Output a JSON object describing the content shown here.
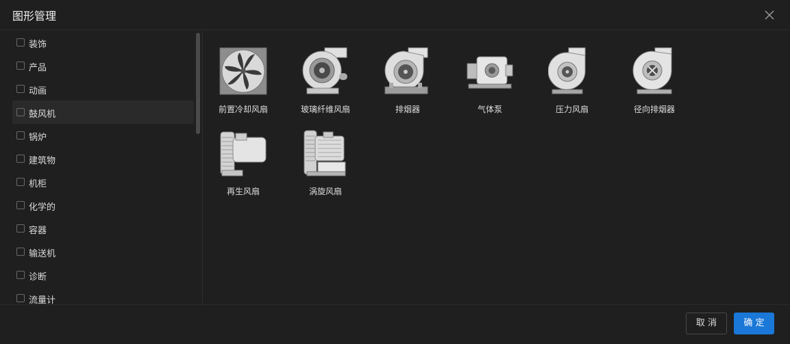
{
  "dialog": {
    "title": "图形管理"
  },
  "sidebar": {
    "items": [
      {
        "label": "装饰"
      },
      {
        "label": "产品"
      },
      {
        "label": "动画"
      },
      {
        "label": "鼓风机"
      },
      {
        "label": "锅炉"
      },
      {
        "label": "建筑物"
      },
      {
        "label": "机柜"
      },
      {
        "label": "化学的"
      },
      {
        "label": "容器"
      },
      {
        "label": "输送机"
      },
      {
        "label": "诊断"
      },
      {
        "label": "流量计"
      }
    ],
    "active_index": 3
  },
  "gallery": {
    "items": [
      {
        "label": "前置冷却风扇",
        "icon": "cooling-fan-icon"
      },
      {
        "label": "玻璃纤维风扇",
        "icon": "fiberglass-fan-icon"
      },
      {
        "label": "排烟器",
        "icon": "smoke-exhauster-icon"
      },
      {
        "label": "气体泵",
        "icon": "gas-pump-icon"
      },
      {
        "label": "压力风扇",
        "icon": "pressure-fan-icon"
      },
      {
        "label": "径向排烟器",
        "icon": "radial-exhauster-icon"
      },
      {
        "label": "再生风扇",
        "icon": "regenerative-blower-icon"
      },
      {
        "label": "涡旋风扇",
        "icon": "vortex-blower-icon"
      }
    ]
  },
  "footer": {
    "cancel_label": "取 消",
    "ok_label": "确 定"
  },
  "colors": {
    "accent": "#1a78d8",
    "background": "#1f1f1f",
    "active_row": "#2a2a2a"
  }
}
